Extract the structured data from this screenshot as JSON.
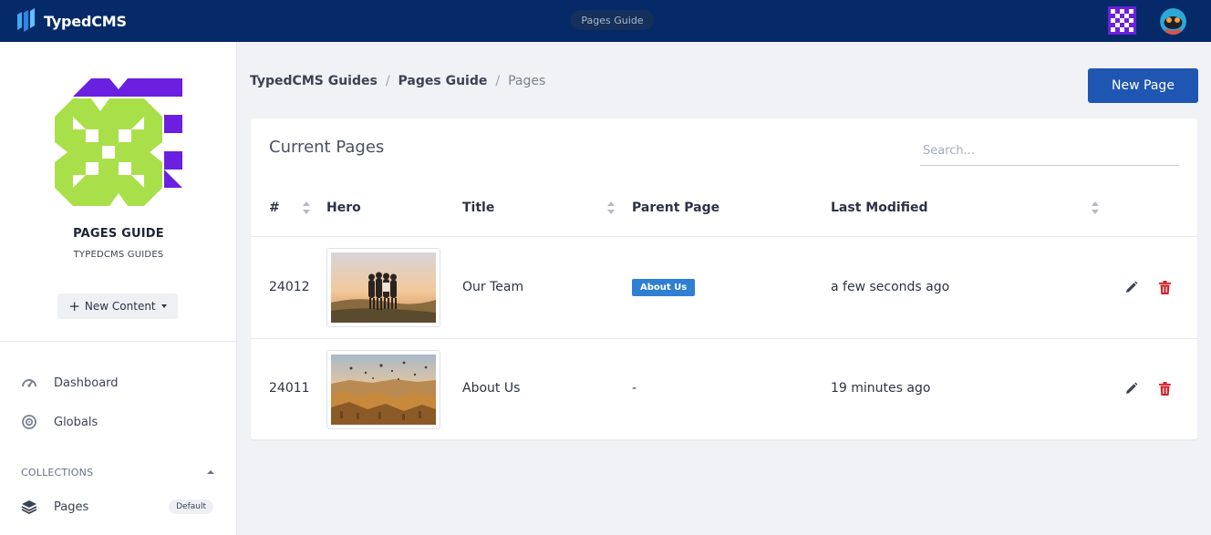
{
  "app": {
    "name": "TypedCMS",
    "center_label": "Pages Guide"
  },
  "sidebar": {
    "project_title": "PAGES GUIDE",
    "project_subtitle": "TYPEDCMS GUIDES",
    "new_content_label": "New Content",
    "nav": [
      {
        "label": "Dashboard",
        "icon": "gauge-icon"
      },
      {
        "label": "Globals",
        "icon": "globe-icon"
      }
    ],
    "collections_heading": "COLLECTIONS",
    "collections": [
      {
        "label": "Pages",
        "icon": "layers-icon",
        "badge": "Default"
      }
    ]
  },
  "breadcrumb": {
    "items": [
      "TypedCMS Guides",
      "Pages Guide"
    ],
    "current": "Pages",
    "separator": "/"
  },
  "toolbar": {
    "new_page_label": "New Page"
  },
  "panel": {
    "title": "Current Pages",
    "search_placeholder": "Search...",
    "columns": [
      "#",
      "Hero",
      "Title",
      "Parent Page",
      "Last Modified"
    ],
    "rows": [
      {
        "id": "24012",
        "title": "Our Team",
        "parent": "About Us",
        "modified": "a few seconds ago",
        "hero": "friends-sunset-image"
      },
      {
        "id": "24011",
        "title": "About Us",
        "parent": "-",
        "modified": "19 minutes ago",
        "hero": "balloons-valley-image"
      }
    ]
  },
  "colors": {
    "topbar": "#062a68",
    "primary_button": "#1e56b2",
    "parent_badge": "#2f7fd3",
    "delete_icon": "#d21f2a",
    "project_art_front": "#a9e04a",
    "project_art_back": "#6b1fe0"
  }
}
